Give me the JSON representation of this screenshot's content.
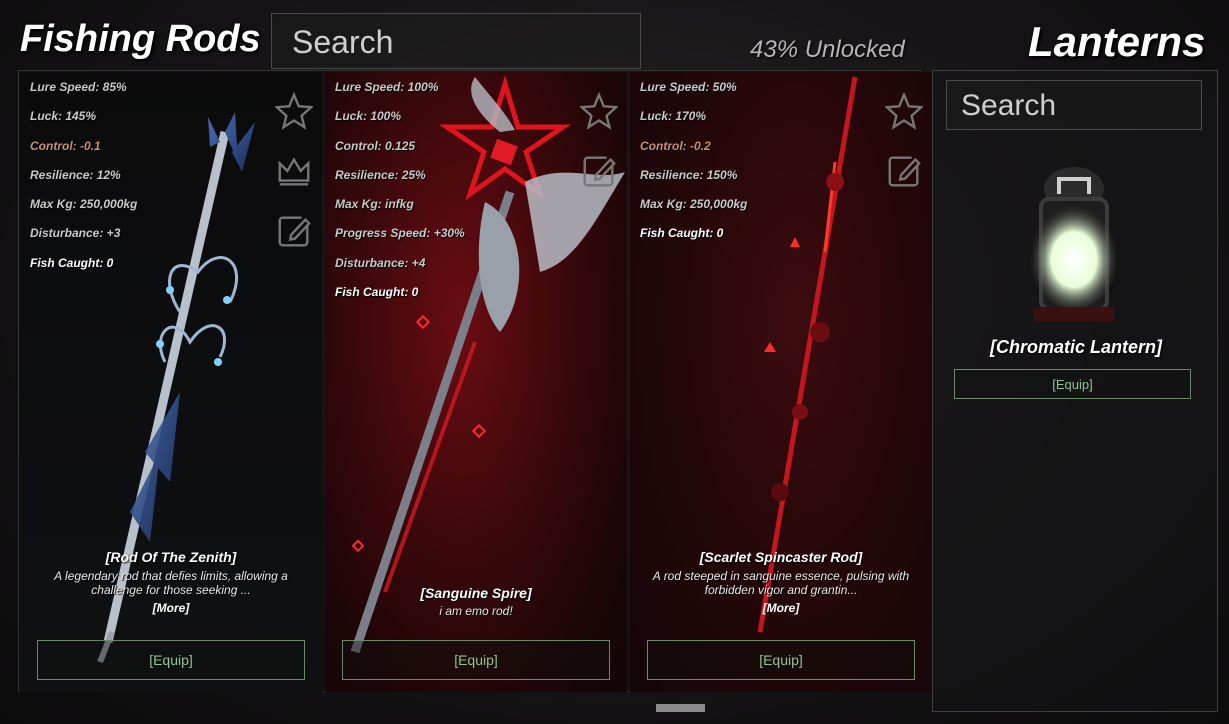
{
  "header": {
    "title": "Fishing Rods",
    "search_placeholder": "Search",
    "unlocked": "43% Unlocked",
    "lanterns_title": "Lanterns"
  },
  "rods": [
    {
      "name": "[Rod Of The Zenith]",
      "description": "A legendary rod that defies limits, allowing a challenge for those seeking ...",
      "more": "[More]",
      "equip": "[Equip]",
      "stats": [
        {
          "text": "Lure Speed: 85%",
          "kind": "normal"
        },
        {
          "text": "Luck: 145%",
          "kind": "normal"
        },
        {
          "text": "Control: -0.1",
          "kind": "neg"
        },
        {
          "text": "Resilience: 12%",
          "kind": "normal"
        },
        {
          "text": "Max Kg: 250,000kg",
          "kind": "normal"
        },
        {
          "text": "Disturbance: +3",
          "kind": "normal"
        },
        {
          "text": "Fish Caught: 0",
          "kind": "caught"
        }
      ],
      "icons": [
        "star-icon",
        "crown-icon",
        "edit-icon"
      ]
    },
    {
      "name": "[Sanguine Spire]",
      "description": "i am emo rod!",
      "more": "",
      "equip": "[Equip]",
      "stats": [
        {
          "text": "Lure Speed: 100%",
          "kind": "normal"
        },
        {
          "text": "Luck: 100%",
          "kind": "normal"
        },
        {
          "text": "Control: 0.125",
          "kind": "normal"
        },
        {
          "text": "Resilience: 25%",
          "kind": "normal"
        },
        {
          "text": "Max Kg: infkg",
          "kind": "normal"
        },
        {
          "text": "Progress Speed: +30%",
          "kind": "normal"
        },
        {
          "text": "Disturbance: +4",
          "kind": "normal"
        },
        {
          "text": "Fish Caught: 0",
          "kind": "caught"
        }
      ],
      "icons": [
        "star-icon",
        "edit-icon"
      ]
    },
    {
      "name": "[Scarlet Spincaster Rod]",
      "description": "A rod steeped in sanguine essence, pulsing with forbidden vigor and grantin...",
      "more": "[More]",
      "equip": "[Equip]",
      "stats": [
        {
          "text": "Lure Speed: 50%",
          "kind": "normal"
        },
        {
          "text": "Luck: 170%",
          "kind": "normal"
        },
        {
          "text": "Control: -0.2",
          "kind": "neg"
        },
        {
          "text": "Resilience: 150%",
          "kind": "normal"
        },
        {
          "text": "Max Kg: 250,000kg",
          "kind": "normal"
        },
        {
          "text": "Fish Caught: 0",
          "kind": "caught"
        }
      ],
      "icons": [
        "star-icon",
        "edit-icon"
      ]
    }
  ],
  "lantern": {
    "search_placeholder": "Search",
    "name": "[Chromatic Lantern]",
    "equip": "[Equip]"
  }
}
